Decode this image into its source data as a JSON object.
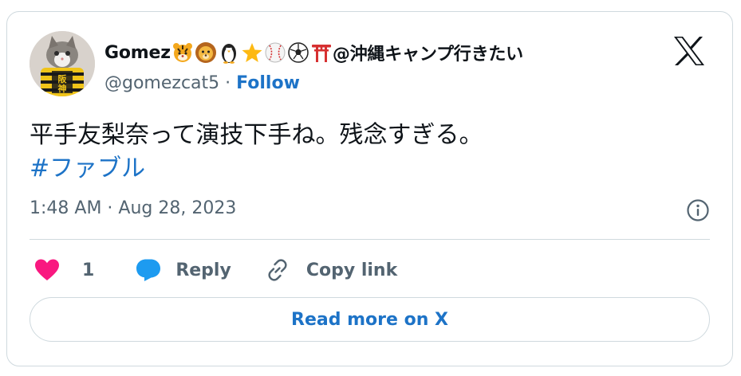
{
  "author": {
    "display_name": "Gomez",
    "display_name_suffix": "@沖縄キャンプ行きたい",
    "name_emojis": [
      "tiger-face-icon",
      "lion-face-icon",
      "penguin-icon",
      "star-icon",
      "baseball-icon",
      "soccer-ball-icon",
      "torii-gate-icon"
    ],
    "avatar_text": "阪神",
    "handle": "@gomezcat5",
    "separator": " · ",
    "follow_label": "Follow"
  },
  "tweet": {
    "text": "平手友梨奈って演技下手ね。残念すぎる。",
    "hashtag": "#ファブル",
    "timestamp": "1:48 AM · Aug 28, 2023"
  },
  "actions": {
    "like_count": "1",
    "reply_label": "Reply",
    "copy_link_label": "Copy link"
  },
  "footer": {
    "read_more_label": "Read more on X"
  },
  "colors": {
    "link_blue": "#1d73c7",
    "like_pink": "#f91880",
    "reply_blue": "#1d9bf0",
    "muted_text": "#536471",
    "border": "#cfd9de"
  }
}
